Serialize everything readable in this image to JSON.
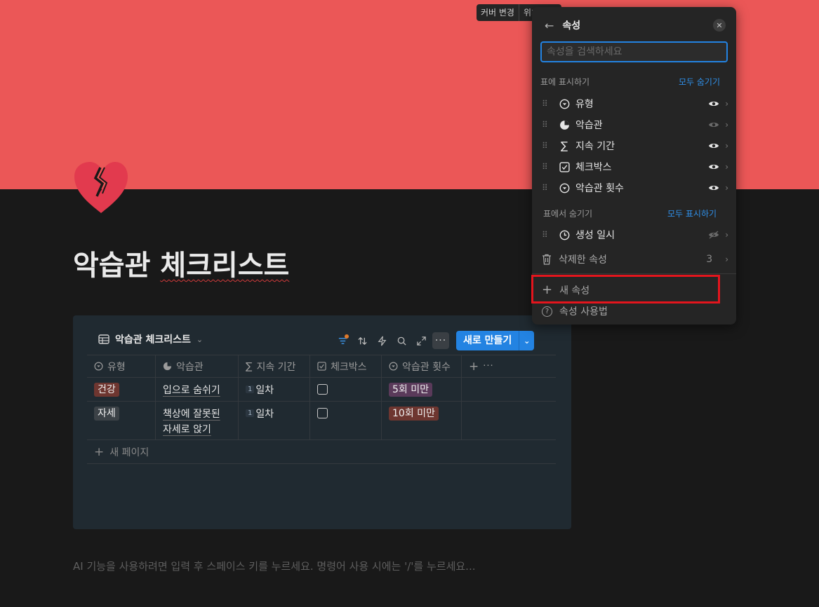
{
  "cover": {
    "color": "#eb5757",
    "actions": [
      "커버 변경",
      "위치 변경"
    ]
  },
  "page": {
    "title_part1": "악습관 ",
    "title_part2": "체크리스트",
    "hint": "AI 기능을 사용하려면 입력 후 스페이스 키를 누르세요. 명령어 사용 시에는 '/'를 누르세요..."
  },
  "database": {
    "title": "악습관 체크리스트",
    "new_button": "새로 만들기",
    "columns": [
      "유형",
      "악습관",
      "지속 기간",
      "체크박스",
      "악습관 횟수"
    ],
    "rows": [
      {
        "type": "건강",
        "habit": "입으로 숨쉬기",
        "duration_num": "1",
        "duration_unit": "일차",
        "checked": false,
        "count": "5회 미만"
      },
      {
        "type": "자세",
        "habit_line1": "책상에 잘못된",
        "habit_line2": "자세로 앉기",
        "duration_num": "1",
        "duration_unit": "일차",
        "checked": false,
        "count": "10회 미만"
      }
    ],
    "new_page": "새 페이지"
  },
  "panel": {
    "title": "속성",
    "search_placeholder": "속성을 검색하세요",
    "shown_label": "표에 표시하기",
    "hide_all": "모두 숨기기",
    "shown": [
      {
        "name": "유형",
        "icon": "select-icon"
      },
      {
        "name": "악습관",
        "icon": "rollup-icon"
      },
      {
        "name": "지속 기간",
        "icon": "formula-icon"
      },
      {
        "name": "체크박스",
        "icon": "checkbox-icon"
      },
      {
        "name": "악습관 횟수",
        "icon": "select-icon"
      }
    ],
    "hidden_label": "표에서 숨기기",
    "show_all": "모두 표시하기",
    "hidden": [
      {
        "name": "생성 일시",
        "icon": "clock-icon"
      }
    ],
    "deleted_label": "삭제한 속성",
    "deleted_count": "3",
    "new_property": "새 속성",
    "help": "속성 사용법"
  }
}
